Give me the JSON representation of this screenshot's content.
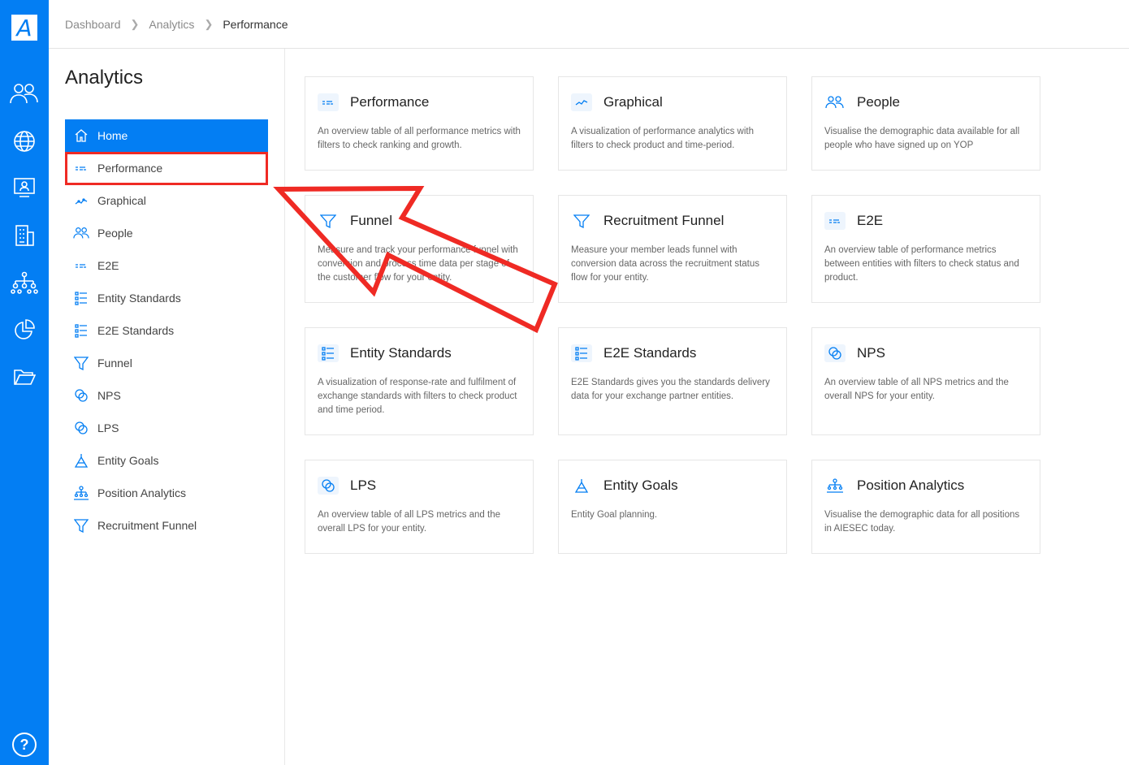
{
  "rail": {
    "logo": "A",
    "icons": [
      "people-icon",
      "globe-icon",
      "monitor-user-icon",
      "building-icon",
      "hierarchy-icon",
      "pie-chart-icon",
      "folder-icon"
    ],
    "help": "?"
  },
  "breadcrumb": [
    "Dashboard",
    "Analytics",
    "Performance"
  ],
  "sidebar": {
    "title": "Analytics",
    "items": [
      {
        "label": "Home",
        "icon": "home-icon"
      },
      {
        "label": "Performance",
        "icon": "table-icon"
      },
      {
        "label": "Graphical",
        "icon": "line-chart-icon"
      },
      {
        "label": "People",
        "icon": "people-icon"
      },
      {
        "label": "E2E",
        "icon": "table-icon"
      },
      {
        "label": "Entity Standards",
        "icon": "list-icon"
      },
      {
        "label": "E2E Standards",
        "icon": "list-icon"
      },
      {
        "label": "Funnel",
        "icon": "funnel-icon"
      },
      {
        "label": "NPS",
        "icon": "nps-icon"
      },
      {
        "label": "LPS",
        "icon": "nps-icon"
      },
      {
        "label": "Entity Goals",
        "icon": "goal-icon"
      },
      {
        "label": "Position Analytics",
        "icon": "hierarchy-icon"
      },
      {
        "label": "Recruitment Funnel",
        "icon": "funnel-icon"
      }
    ]
  },
  "cards": [
    {
      "title": "Performance",
      "icon": "table-icon",
      "desc": "An overview table of all performance metrics with filters to check ranking and growth."
    },
    {
      "title": "Graphical",
      "icon": "line-chart-icon",
      "desc": "A visualization of performance analytics with filters to check product and time-period."
    },
    {
      "title": "People",
      "icon": "people-icon",
      "desc": "Visualise the demographic data available for all people who have signed up on YOP"
    },
    {
      "title": "Funnel",
      "icon": "funnel-icon",
      "desc": "Measure and track your performance funnel with conversion and process time data per stage of the customer flow for your entity."
    },
    {
      "title": "Recruitment Funnel",
      "icon": "funnel-icon",
      "desc": "Measure your member leads funnel with conversion data across the recruitment status flow for your entity."
    },
    {
      "title": "E2E",
      "icon": "table-icon",
      "desc": "An overview table of performance metrics between entities with filters to check status and product."
    },
    {
      "title": "Entity Standards",
      "icon": "list-icon",
      "desc": "A visualization of response-rate and fulfilment of exchange standards with filters to check product and time period."
    },
    {
      "title": "E2E Standards",
      "icon": "list-icon",
      "desc": "E2E Standards gives you the standards delivery data for your exchange partner entities."
    },
    {
      "title": "NPS",
      "icon": "nps-icon",
      "desc": "An overview table of all NPS metrics and the overall NPS for your entity."
    },
    {
      "title": "LPS",
      "icon": "nps-icon",
      "desc": "An overview table of all LPS metrics and the overall LPS for your entity."
    },
    {
      "title": "Entity Goals",
      "icon": "goal-icon",
      "desc": "Entity Goal planning."
    },
    {
      "title": "Position Analytics",
      "icon": "hierarchy-icon",
      "desc": "Visualise the demographic data for all positions in AIESEC today."
    }
  ],
  "colors": {
    "brand": "#037ef3",
    "annotation": "#ef2a24"
  }
}
